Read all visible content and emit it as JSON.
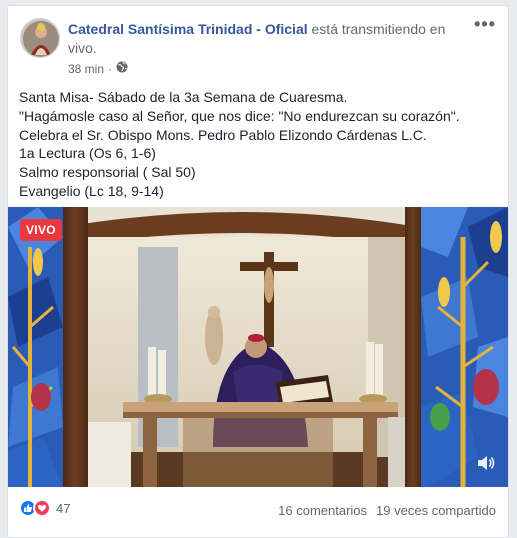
{
  "post": {
    "page_name": "Catedral Santísima Trinidad - Oficial",
    "action_text": " está transmitiendo en vivo.",
    "timestamp": "38 min",
    "separator": "·",
    "privacy_icon": "globe-icon",
    "more_icon": "ellipsis-icon",
    "more_label": "•••",
    "lines": [
      "Santa Misa- Sábado de la 3a Semana de Cuaresma.",
      "\"Hagámosle caso al Señor, que nos dice: \"No endurezcan su corazón\".",
      "Celebra el Sr. Obispo Mons. Pedro Pablo Elizondo Cárdenas L.C.",
      "1a Lectura (Os 6, 1-6)",
      "Salmo responsorial ( Sal 50)",
      "Evangelio (Lc 18, 9-14)"
    ]
  },
  "video": {
    "live_label": "VIVO",
    "volume_icon": "volume-icon"
  },
  "footer": {
    "reaction_icons": [
      "like-icon",
      "love-icon"
    ],
    "reaction_count": "47",
    "comments": "16 comentarios",
    "shares": "19 veces compartido"
  },
  "colors": {
    "link": "#365899",
    "live": "#e9383f",
    "like": "#1877f2",
    "love": "#f33e58"
  }
}
